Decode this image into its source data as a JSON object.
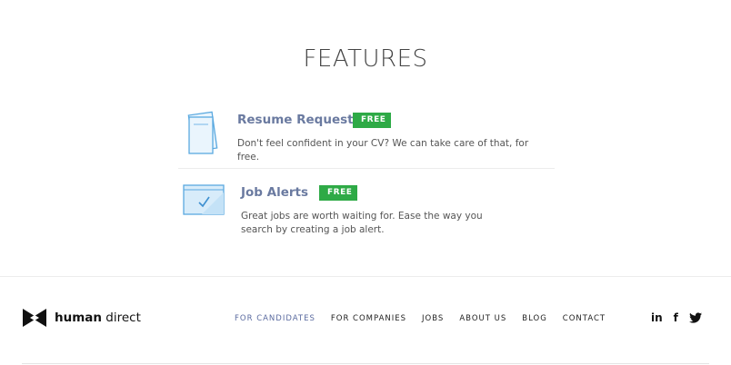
{
  "features": {
    "title": "FEATURES",
    "items": [
      {
        "name": "Resume Request",
        "badge": "FREE",
        "description": "Don't feel confident in your CV? We can take care of that, for free.",
        "icon": "document-icon"
      },
      {
        "name": "Job Alerts",
        "badge": "FREE",
        "description": "Great jobs are worth waiting for. Ease the way you search by creating a job alert.",
        "icon": "alert-window-icon"
      }
    ]
  },
  "footer": {
    "logo": {
      "bold": "human",
      "regular": " direct"
    },
    "nav": [
      {
        "label": "FOR CANDIDATES",
        "active": true
      },
      {
        "label": "FOR COMPANIES",
        "active": false
      },
      {
        "label": "JOBS",
        "active": false
      },
      {
        "label": "ABOUT US",
        "active": false
      },
      {
        "label": "BLOG",
        "active": false
      },
      {
        "label": "CONTACT",
        "active": false
      }
    ],
    "social": [
      {
        "label": "in",
        "icon": "linkedin-icon"
      },
      {
        "label": "f",
        "icon": "facebook-icon"
      },
      {
        "label": "",
        "icon": "twitter-icon"
      }
    ]
  },
  "colors": {
    "badge": "#2eaa46",
    "feature_name": "#6a7aa0",
    "active_nav": "#5b6ba0",
    "icon_blue": "#5aa9e0"
  }
}
